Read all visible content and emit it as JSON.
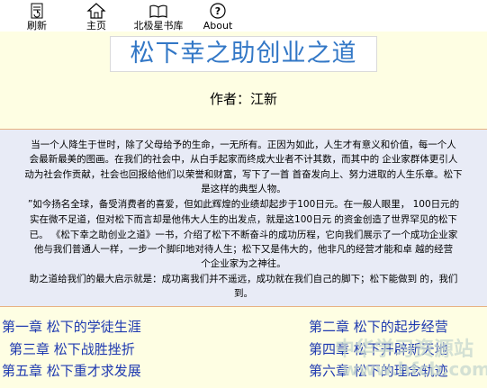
{
  "toolbar": {
    "refresh": "刷新",
    "home": "主页",
    "library": "北极星书库",
    "about": "About"
  },
  "book": {
    "title": "松下幸之助创业之道",
    "author": "作者：江新"
  },
  "intro": {
    "lines": [
      "当一个人降生于世时，除了父母给予的生命，一无所有。正因为如此，人生才有意义和价值，每一个人",
      "会最新最美的图画。在我们的社会中，从白手起家而终成大业者不计其数，而其中的  企业家群体更引人",
      "动为社会作贡献，社会也回报给他们以荣誉和财富，写下了一首  首奋发向上、努力进取的人生乐章。松下",
      "是这样的典型人物。",
      "”如今扬名全球，备受消费者的喜爱，但如此辉煌的业绩却起步于100日元。在一般人眼里，  100日元的",
      "实在微不足道，但对松下而言却是他伟大人生的出发点，就是这100日元 的资金创造了世界罕见的松下",
      "已。  《松下幸之助创业之道》一书，介绍了松下不断奋斗的成功历程，它向我们展示了一个成功企业家",
      "  他与我们普通人一样，一步一个脚印地对待人生；松下又是伟大的，他非凡的经营才能和卓  越的经营",
      "个企业家为之神往。",
      "助之道给我们的最大启示就是：成功离我们并不遥远，成功就在我们自己的脚下；松下能做到  的，我们",
      "到。"
    ]
  },
  "chapters": [
    "第一章    松下的学徒生涯",
    "第二章    松下的起步经营",
    "第三章    松下战胜挫折",
    "第四章    松下开辟新天地",
    "第五章    松下重才求发展",
    "第六章    松下的理念轨迹"
  ],
  "watermark": {
    "line1": "中华学习资源站",
    "line2": "www.hfcb.com"
  },
  "colors": {
    "page_bg": "#fefee3",
    "title_text": "#3277c6",
    "intro_bg": "#e8ebf6",
    "intro_border": "#e7b282",
    "chapter_link": "#1f3ab0"
  },
  "icons": {
    "refresh": "document-refresh-icon",
    "home": "house-icon",
    "library": "open-book-icon",
    "about": "help-question-icon"
  }
}
